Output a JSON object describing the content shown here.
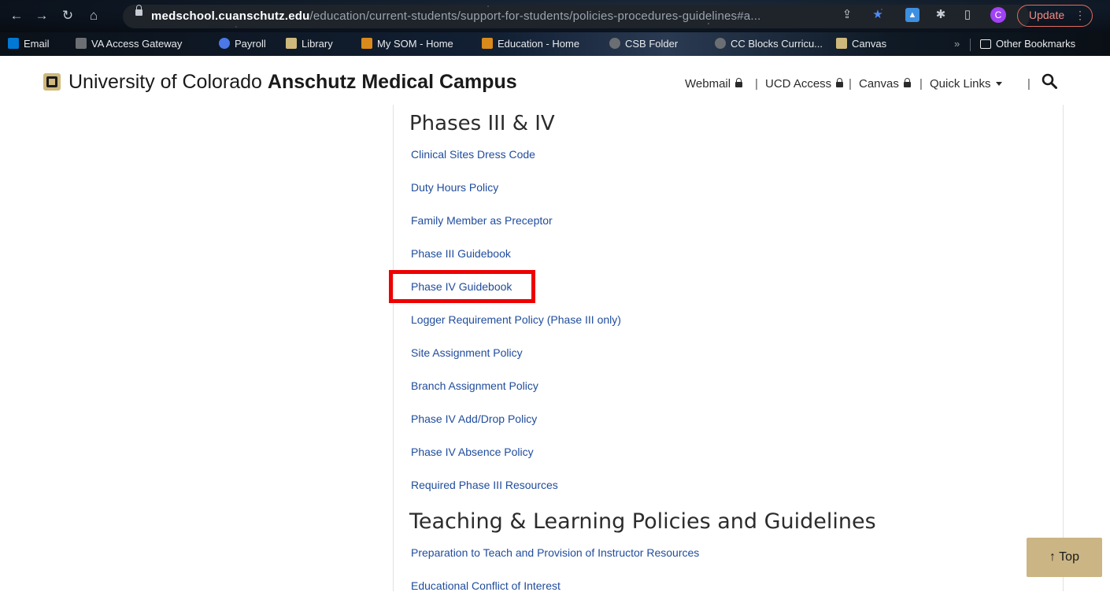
{
  "browser": {
    "url_host": "medschool.cuanschutz.edu",
    "url_path": "/education/current-students/support-for-students/policies-procedures-guidelines#a...",
    "profile_initial": "C",
    "update_label": "Update",
    "update_menu": "⋮",
    "bookmarks": [
      {
        "label": "Email",
        "icon_color": "#0078d4"
      },
      {
        "label": "VA Access Gateway",
        "icon_color": "#6b6f73"
      },
      {
        "label": "Payroll",
        "icon_color": "#4b78e6"
      },
      {
        "label": "Library",
        "icon_color": "#cfb87c"
      },
      {
        "label": "My SOM - Home",
        "icon_color": "#d98a1a"
      },
      {
        "label": "Education - Home",
        "icon_color": "#d98a1a"
      },
      {
        "label": "CSB Folder",
        "icon_color": "#6b6f73"
      },
      {
        "label": "CC Blocks Curricu...",
        "icon_color": "#6b6f73"
      },
      {
        "label": "Canvas",
        "icon_color": "#cfb87c"
      }
    ],
    "bookmarks_overflow": "»",
    "other_bookmarks": "Other Bookmarks"
  },
  "site": {
    "campus_prefix": "University of Colorado ",
    "campus_bold": "Anschutz Medical Campus",
    "util": {
      "webmail": "Webmail",
      "ucd_access": "UCD Access",
      "canvas": "Canvas",
      "quick_links": "Quick Links",
      "separator": "|"
    }
  },
  "content": {
    "section1_title": "Phases III & IV",
    "section1_links": [
      "Clinical Sites Dress Code",
      "Duty Hours Policy",
      "Family Member as Preceptor",
      "Phase III Guidebook",
      "Phase IV Guidebook",
      "Logger Requirement Policy (Phase III only)",
      "Site Assignment Policy",
      "Branch Assignment Policy",
      "Phase IV Add/Drop Policy",
      "Phase IV Absence Policy",
      "Required Phase III Resources"
    ],
    "section2_title": "Teaching & Learning Policies and Guidelines",
    "section2_links": [
      "Preparation to Teach and Provision of Instructor Resources",
      "Educational Conflict of Interest"
    ]
  },
  "top_button": {
    "arrow": "↑",
    "label": "Top"
  },
  "colors": {
    "link": "#1f4c9c",
    "highlight_box": "#ee0000",
    "top_button_bg": "#cbb584",
    "cu_gold": "#cfb87c"
  }
}
